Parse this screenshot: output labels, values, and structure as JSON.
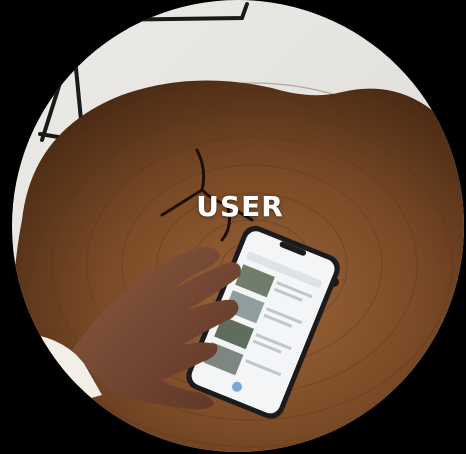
{
  "caption": "USER",
  "colors": {
    "background": "#000000",
    "wall": "#e9e7e3",
    "wood_dark": "#4a2a14",
    "wood_mid": "#7a4a26",
    "wood_light": "#9a6438",
    "phone_frame": "#1b1b1d",
    "phone_screen": "#f4f5f6",
    "skin": "#7a4a35",
    "sleeve": "#f2efe9",
    "caption_text": "#ffffff"
  },
  "scene": {
    "subject": "hand-holding-phone-on-wood-slab",
    "elements": [
      "wall",
      "cable",
      "wood-slab",
      "tree-rings",
      "wood-crack",
      "smartphone",
      "hand",
      "sleeve"
    ]
  }
}
